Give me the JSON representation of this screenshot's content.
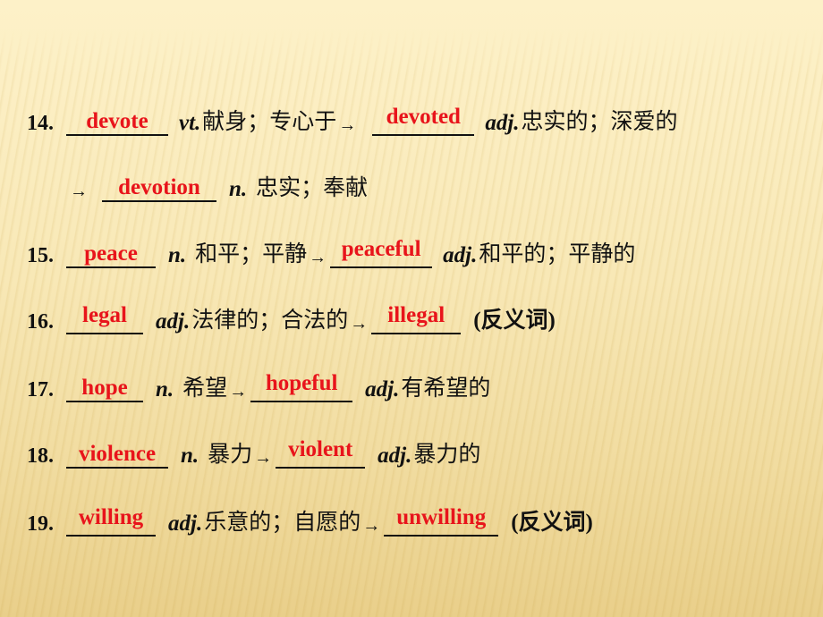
{
  "slide": {
    "items": [
      {
        "number": "14.",
        "answer1": "devote",
        "pos1": "vt.",
        "meaning1": "献身；专心于",
        "arrow": "→",
        "answer2": "devoted",
        "pos2": "adj.",
        "meaning2": "忠实的；深爱的",
        "cont_arrow": "→",
        "answer3": "devotion",
        "pos3": "n.",
        "meaning3": "忠实；奉献"
      },
      {
        "number": "15.",
        "answer1": "peace",
        "pos1": "n.",
        "meaning1": "和平；平静",
        "arrow": "→",
        "answer2": "peaceful",
        "pos2": "adj.",
        "meaning2": "和平的；平静的"
      },
      {
        "number": "16.",
        "answer1": "legal",
        "pos1": "adj.",
        "meaning1": "法律的；合法的",
        "arrow": "→",
        "answer2": "illegal",
        "note": "(反义词)"
      },
      {
        "number": "17.",
        "answer1": "hope",
        "pos1": "n.",
        "meaning1": "希望",
        "arrow": "→",
        "answer2": "hopeful",
        "pos2": "adj.",
        "meaning2": "有希望的"
      },
      {
        "number": "18.",
        "answer1": "violence",
        "pos1": "n.",
        "meaning1": "暴力",
        "arrow": "→",
        "answer2": "violent",
        "pos2": "adj.",
        "meaning2": "暴力的"
      },
      {
        "number": "19.",
        "answer1": "willing",
        "pos1": "adj.",
        "meaning1": "乐意的；自愿的",
        "arrow": "→",
        "answer2": "unwilling",
        "note": "(反义词)"
      }
    ]
  },
  "colors": {
    "answer": "#e8141b",
    "text": "#111111",
    "background_top": "#fdf1c8",
    "background_bottom": "#e9cf8a"
  }
}
